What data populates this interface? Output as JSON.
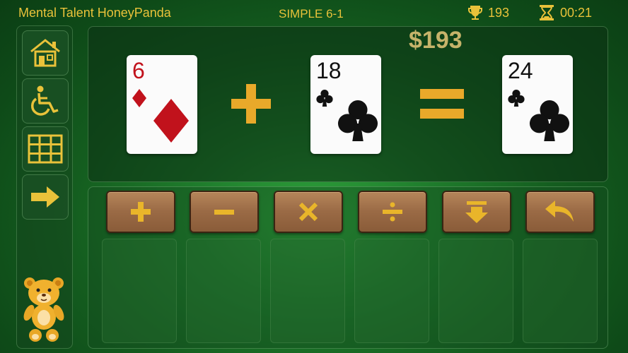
{
  "header": {
    "app_title": "Mental Talent HoneyPanda",
    "level": "SIMPLE 6-1",
    "score": "193",
    "timer": "00:21"
  },
  "sidebar": {
    "items": [
      {
        "name": "home",
        "icon": "home-icon"
      },
      {
        "name": "accessibility",
        "icon": "wheelchair-icon"
      },
      {
        "name": "grid",
        "icon": "grid-icon"
      },
      {
        "name": "next",
        "icon": "arrow-right-icon"
      }
    ],
    "mascot": "bear-icon"
  },
  "board": {
    "money": "$193",
    "card1": {
      "rank": "6",
      "suit": "diamonds"
    },
    "operator": "+",
    "card2": {
      "rank": "18",
      "suit": "clubs"
    },
    "equals": "=",
    "result": {
      "rank": "24",
      "suit": "clubs"
    }
  },
  "operations": [
    {
      "name": "add",
      "icon": "plus-icon"
    },
    {
      "name": "subtract",
      "icon": "minus-icon"
    },
    {
      "name": "multiply",
      "icon": "times-icon"
    },
    {
      "name": "divide",
      "icon": "divide-icon"
    },
    {
      "name": "drop",
      "icon": "down-arrow-icon"
    },
    {
      "name": "undo",
      "icon": "undo-icon"
    }
  ],
  "colors": {
    "accent": "#e9c23a",
    "felt": "#1f7d2c",
    "button_wood": "#9a6a45",
    "suit_red": "#c1121c"
  }
}
